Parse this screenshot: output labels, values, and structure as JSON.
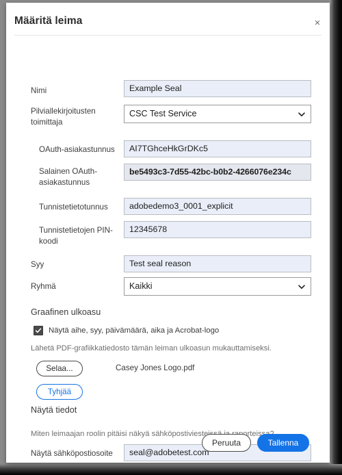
{
  "dialog": {
    "title": "Määritä leima",
    "close_label": "×"
  },
  "fields": {
    "name": {
      "label": "Nimi",
      "value": "Example Seal"
    },
    "provider": {
      "label": "Pilviallekirjoitusten toimittaja",
      "value": "CSC Test Service"
    },
    "oauth_client_id": {
      "label": "OAuth-asiakastunnus",
      "value": "AI7TGhceHkGrDKc5"
    },
    "oauth_client_secret": {
      "label": "Salainen OAuth-asiakastunnus",
      "value": "be5493c3-7d55-42bc-b0b2-4266076e234c"
    },
    "credential_id": {
      "label": "Tunnistetietotunnus",
      "value": "adobedemo3_0001_explicit"
    },
    "credential_pin": {
      "label": "Tunnistetietojen PIN-koodi",
      "value": "12345678"
    },
    "reason": {
      "label": "Syy",
      "value": "Test seal reason"
    },
    "group": {
      "label": "Ryhmä",
      "value": "Kaikki"
    },
    "email": {
      "label": "Näytä sähköpostiosoite",
      "value": "seal@adobetest.com"
    }
  },
  "appearance": {
    "section_title": "Graafinen ulkoasu",
    "checkbox_label": "Näytä aihe, syy, päivämäärä, aika ja Acrobat-logo",
    "checkbox_checked": true,
    "upload_hint": "Lähetä PDF-grafiikkatiedosto tämän leiman ulkoasun mukauttamiseksi.",
    "browse_label": "Selaa...",
    "clear_label": "Tyhjää",
    "file_name": "Casey Jones Logo.pdf"
  },
  "details": {
    "section_title": "Näytä tiedot",
    "hint": "Miten leimaajan roolin pitäisi näkyä sähköpostiviesteissä ja raporteissa?"
  },
  "footer": {
    "cancel_label": "Peruuta",
    "save_label": "Tallenna"
  },
  "colors": {
    "accent": "#1473e6",
    "input_fill": "#e9eef8",
    "input_fill_secret": "#e4e7ee",
    "border": "#b9bcc2",
    "text": "#3d3d3d"
  }
}
